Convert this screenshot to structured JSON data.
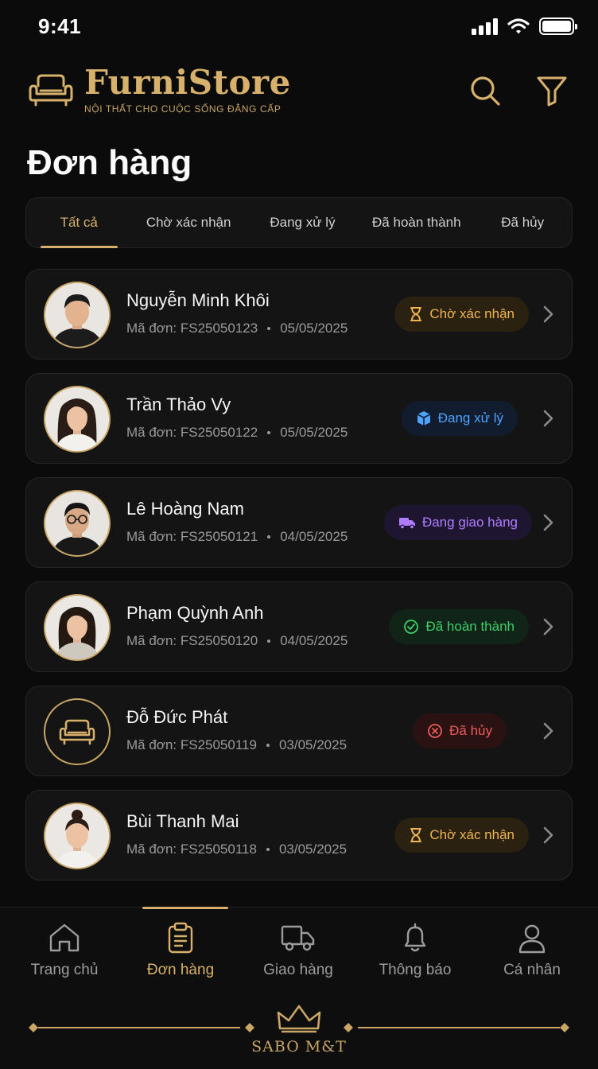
{
  "status_bar": {
    "time": "9:41"
  },
  "brand": {
    "name": "FurniStore",
    "tagline": "NỘI THẤT CHO CUỘC SỐNG ĐẲNG CẤP"
  },
  "page": {
    "title": "Đơn hàng"
  },
  "tabs": [
    {
      "label": "Tất cả",
      "active": true
    },
    {
      "label": "Chờ xác nhận"
    },
    {
      "label": "Đang xử lý"
    },
    {
      "label": "Đã hoàn thành"
    },
    {
      "label": "Đã hủy"
    }
  ],
  "orders": [
    {
      "name": "Nguyễn Minh Khôi",
      "code": "Mã đơn: FS25050123",
      "date": "05/05/2025",
      "status": "Chờ xác nhận",
      "status_icon": "hourglass-icon",
      "status_color": "#f0b552"
    },
    {
      "name": "Trần Thảo Vy",
      "code": "Mã đơn: FS25050122",
      "date": "05/05/2025",
      "status": "Đang xử lý",
      "status_icon": "box-icon",
      "status_color": "#4da3ff"
    },
    {
      "name": "Lê Hoàng Nam",
      "code": "Mã đơn: FS25050121",
      "date": "04/05/2025",
      "status": "Đang giao hàng",
      "status_icon": "truck-icon",
      "status_color": "#b07cff"
    },
    {
      "name": "Phạm Quỳnh Anh",
      "code": "Mã đơn: FS25050120",
      "date": "04/05/2025",
      "status": "Đã hoàn thành",
      "status_icon": "check-circle-icon",
      "status_color": "#3ecf6a"
    },
    {
      "name": "Đỗ Đức Phát",
      "code": "Mã đơn: FS25050119",
      "date": "03/05/2025",
      "status": "Đã hủy",
      "status_icon": "x-circle-icon",
      "status_color": "#ef5a5a"
    },
    {
      "name": "Bùi Thanh Mai",
      "code": "Mã đơn: FS25050118",
      "date": "03/05/2025",
      "status": "Chờ xác nhận",
      "status_icon": "hourglass-icon",
      "status_color": "#f0b552"
    }
  ],
  "bottom_nav": [
    {
      "label": "Trang chủ",
      "icon": "home-icon"
    },
    {
      "label": "Đơn hàng",
      "icon": "clipboard-icon",
      "active": true
    },
    {
      "label": "Giao hàng",
      "icon": "truck-icon"
    },
    {
      "label": "Thông báo",
      "icon": "bell-icon"
    },
    {
      "label": "Cá nhân",
      "icon": "user-icon"
    }
  ],
  "footer": {
    "brand": "SABO M&T"
  },
  "colors": {
    "accent": "#d7b16b",
    "background": "#0b0b0b",
    "card": "#141414"
  }
}
